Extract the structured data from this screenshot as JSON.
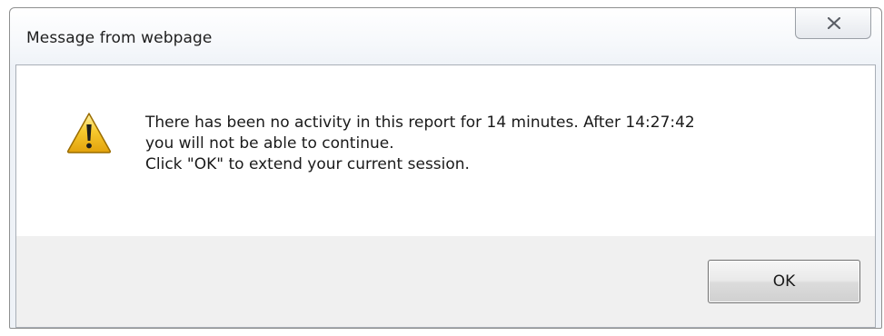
{
  "dialog": {
    "title": "Message from webpage",
    "close_icon": "close-x-icon",
    "warning_icon": "warning-triangle-icon",
    "message_lines": [
      "There has been no activity in this report for 14 minutes. After 14:27:42",
      "you will not be able to continue.",
      "Click \"OK\" to extend your current session."
    ],
    "ok_label": "OK"
  },
  "colors": {
    "warning_fill": "#f7c92e",
    "warning_stroke": "#9a6c00",
    "button_area": "#f0f0f0"
  }
}
